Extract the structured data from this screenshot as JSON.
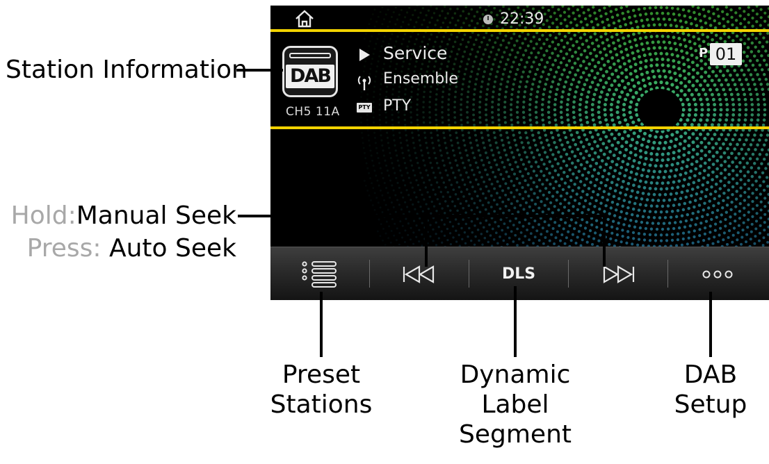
{
  "status_bar": {
    "home_icon": "home-icon",
    "clock_icon": "clock-icon",
    "time": "22:39"
  },
  "station_info": {
    "logo_text": "DAB",
    "channel": "CH5  11A",
    "service": "Service",
    "ensemble": "Ensemble",
    "pty_icon_text": "PTY",
    "pty": "PTY",
    "preset_prefix": "P",
    "preset_number": "01",
    "highlight_color": "#f2d200"
  },
  "controls": [
    {
      "name": "preset-list",
      "icon": "list-icon"
    },
    {
      "name": "seek-back",
      "icon": "skip-back-icon"
    },
    {
      "name": "dls",
      "label": "DLS"
    },
    {
      "name": "seek-forward",
      "icon": "skip-forward-icon"
    },
    {
      "name": "dab-setup",
      "icon": "more-icon"
    }
  ],
  "callouts": {
    "station_information": "Station Information",
    "hold_prefix": "Hold:",
    "hold_action": "Manual Seek",
    "press_prefix": "Press:",
    "press_action": "Auto Seek",
    "preset_line1": "Preset",
    "preset_line2": "Stations",
    "dls_line1": "Dynamic",
    "dls_line2": "Label",
    "dls_line3": "Segment",
    "setup_line1": "DAB",
    "setup_line2": "Setup"
  }
}
